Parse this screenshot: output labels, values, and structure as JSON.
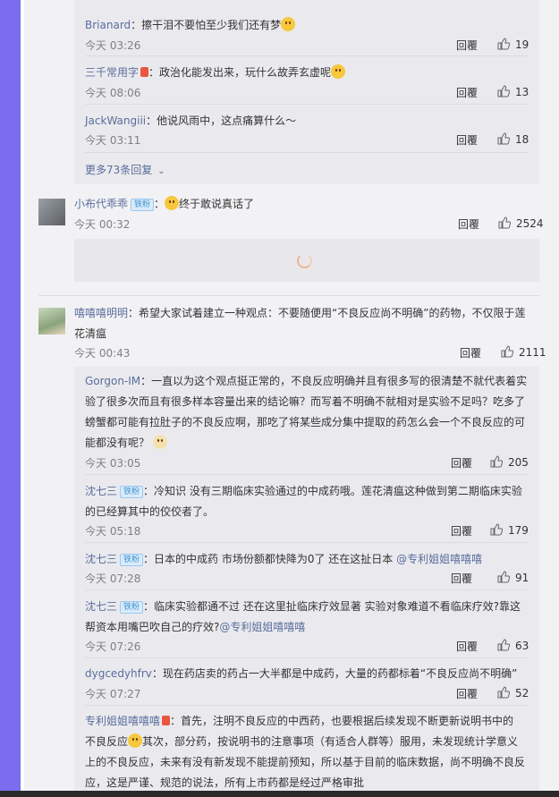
{
  "colors": {
    "accent_purple": "#7b6cf0",
    "name_blue": "#5a6d9c",
    "panel": "#f2f2f5",
    "sub_box": "#eaeaee"
  },
  "replies_top": [
    {
      "user": "Brianard",
      "text": "：擦干泪不要怕至少我们还有梦",
      "time": "今天 03:26",
      "reply": "回覆",
      "likes": "19"
    },
    {
      "user": "三千常用字",
      "text": "：政治化能发出来，玩什么故弄玄虚呢",
      "time": "今天 08:06",
      "reply": "回覆",
      "likes": "13"
    },
    {
      "user": "JackWangiii",
      "text": "：他说风雨中，这点痛算什么～",
      "time": "今天 03:11",
      "reply": "回覆",
      "likes": "18"
    }
  ],
  "more_replies": "更多73条回复",
  "comment1": {
    "user": "小布代乖乖",
    "badge": "铁粉",
    "text": "：",
    "text2": "终于敢说真话了",
    "time": "今天 00:32",
    "reply": "回覆",
    "likes": "2524"
  },
  "comment2": {
    "user": "嘻嘻嘻明明",
    "text": "：希望大家试着建立一种观点：不要随便用“不良反应尚不明确”的药物，不仅限于莲",
    "text_line2": "花清瘟",
    "time": "今天 00:43",
    "reply": "回覆",
    "likes": "2111"
  },
  "replies_bottom": [
    {
      "user": "Gorgon-IM",
      "line1": "：一直以为这个观点挺正常的，不良反应明确并且有很多写的很清楚不就代表着实",
      "line2": "验了很多次而且有很多样本容量出来的结论嘛？而写着不明确不就相对是实验不足吗？吃多了",
      "line3": "螃蟹都可能有拉肚子的不良反应啊，那吃了将某些成分集中提取的药怎么会一个不良反应的可",
      "line4": "能都没有呢？",
      "time": "今天 03:05",
      "reply": "回覆",
      "likes": "205"
    },
    {
      "user": "沈七三",
      "badge": "铁粉",
      "line1": "：冷知识 没有三期临床实验通过的中成药哦。莲花清瘟这种做到第二期临床实验",
      "line2": "的已经算其中的佼佼者了。",
      "time": "今天 05:18",
      "reply": "回覆",
      "likes": "179"
    },
    {
      "user": "沈七三",
      "badge": "铁粉",
      "line1": "：日本的中成药 市场份额都快降为0了 还在这扯日本 ",
      "mention": "@专利姐姐嘻嘻嘻",
      "time": "今天 07:28",
      "reply": "回覆",
      "likes": "91"
    },
    {
      "user": "沈七三",
      "badge": "铁粉",
      "line1": "：临床实验都通不过 还在这里扯临床疗效显著 实验对象难道不看临床疗效?靠这",
      "line2": "帮资本用嘴巴吹自己的疗效?",
      "mention": "@专利姐姐嘻嘻嘻",
      "time": "今天 07:26",
      "reply": "回覆",
      "likes": "63"
    },
    {
      "user": "dygcedyhfrv",
      "line1": "：现在药店卖的药占一大半都是中成药，大量的药都标着“不良反应尚不明确”",
      "time": "今天 07:27",
      "reply": "回覆",
      "likes": "52"
    },
    {
      "user": "专利姐姐嘻嘻嘻",
      "line1": "：首先，注明不良反应的中西药，也要根据后续发现不断更新说明书中的",
      "line2a": "不良反应",
      "line2b": "其次，部分药，按说明书的注意事项（有适合人群等）服用，未发现统计学意义",
      "line3": "上的不良反应，未来有没有新发现不能提前预知，所以基于目前的临床数据，尚不明确不良反",
      "line4": "应，这是严谨、规范的说法，所有上市药都是经过严格审批"
    }
  ]
}
